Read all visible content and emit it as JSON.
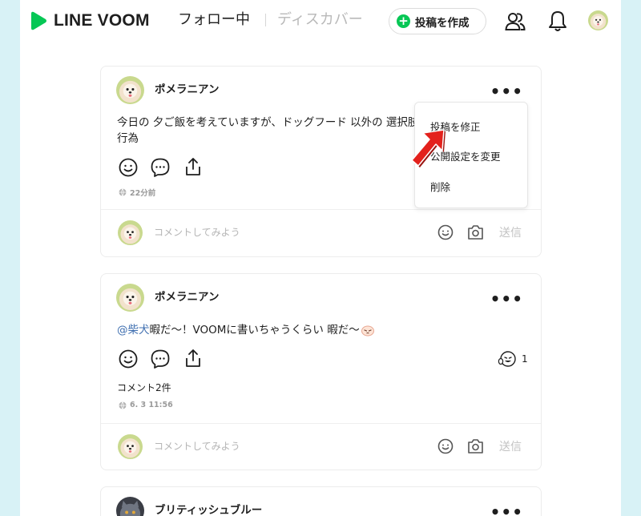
{
  "header": {
    "logo_text": "LINE VOOM",
    "tab_follow": "フォロー中",
    "tab_discover": "ディスカバー",
    "create_label": "投稿を作成"
  },
  "posts": [
    {
      "username": "ポメラニアン",
      "text_line1": "今日の 夕ご飯を考えていますが、ドッグフード 以外の 選択肢",
      "text_line2": "行為",
      "time": "22分前",
      "comment_placeholder": "コメントしてみよう",
      "send_label": "送信"
    },
    {
      "username": "ポメラニアン",
      "mention": "@柴犬",
      "text": " 暇だ～！VOOMに書いちゃうくらい 暇だ～",
      "reaction_count": "1",
      "comments": "コメント2件",
      "time": "6. 3 11:56",
      "comment_placeholder": "コメントしてみよう",
      "send_label": "送信"
    },
    {
      "username": "ブリティッシュブルー"
    }
  ],
  "menu": {
    "items": [
      "投稿を修正",
      "公開設定を変更",
      "削除"
    ]
  },
  "colors": {
    "accent": "#06c755",
    "background": "#d8f2f6",
    "arrow": "#e3211c"
  }
}
